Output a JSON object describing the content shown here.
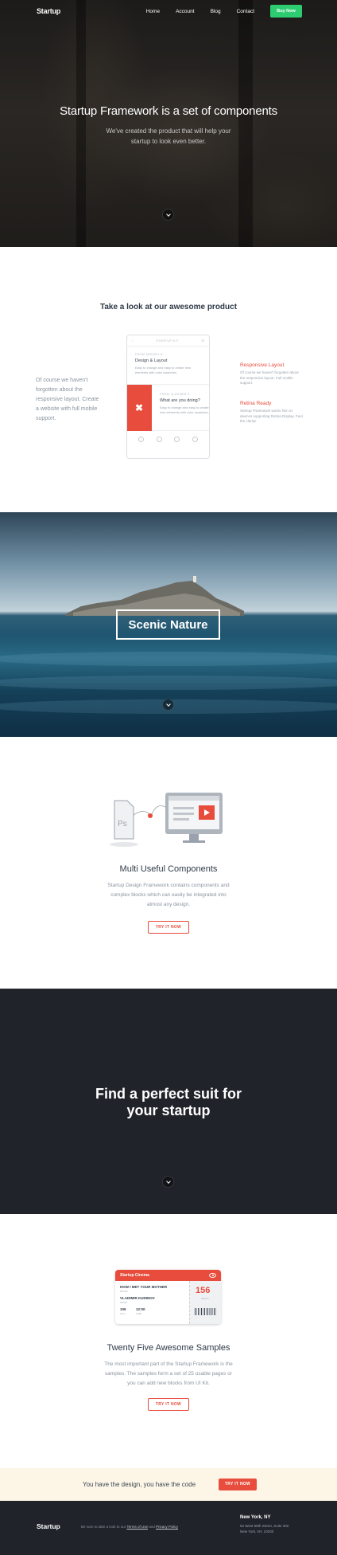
{
  "nav": {
    "brand": "Startup",
    "links": [
      "Home",
      "Account",
      "Blog",
      "Contact"
    ],
    "cta_label": "Buy Now",
    "cta_color": "#2ecc71"
  },
  "hero": {
    "title": "Startup Framework is a set of components",
    "subtitle": "We've created the product that will help your startup to look even better."
  },
  "product": {
    "title": "Take a look at our awesome product",
    "left_text": "Of course we haven't forgotten about the responsive layout. Create a website with full mobile support.",
    "phone": {
      "header": "STARTUP KIT",
      "item1_meta": "FROM SERGEY K.",
      "item1_title": "Design & Layout",
      "item1_body": "Easy to change and easy to create new elements with color swatches.",
      "item2_meta": "FROM VLADIMIR K.",
      "item2_title": "What are you doing?",
      "item2_body": "Easy to change and easy to create new elements with color swatches.",
      "item2_icon": "close-icon"
    },
    "features": [
      {
        "title": "Responsive Layout",
        "body": "Of course we haven't forgotten about the responsive layout. Full mobile support."
      },
      {
        "title": "Retina Ready",
        "body": "Startup Framework works fine on devices supporting Retina Display. Feel the clarity!"
      }
    ],
    "accent_color": "#e74c3c"
  },
  "nature": {
    "label": "Scenic Nature"
  },
  "components": {
    "title": "Multi Useful Components",
    "body": "Startup Design Framework contains components and complex blocks which can easily be integrated into almost any design.",
    "button": "TRY IT NOW"
  },
  "suit": {
    "title_line1": "Find a perfect suit for",
    "title_line2": "your startup"
  },
  "samples": {
    "ticket": {
      "header": "Startup Cinema",
      "movie": "HOW I MET YOUR MOTHER",
      "movie_label": "MOVIE",
      "name": "VLADIMIR KUDINOV",
      "name_label": "NAME",
      "hall": "106",
      "hall_label": "HALL",
      "time": "12:00",
      "time_label": "TIME",
      "seat_number": "156",
      "seat_label": "SEATS"
    },
    "title": "Twenty Five Awesome Samples",
    "body": "The most important part of the Startup Framework is the samples. The samples form a set of 25 usable pages or you can add new blocks from UI Kit.",
    "button": "TRY IT NOW"
  },
  "cta": {
    "text": "You have the design, you have the code",
    "button": "TRY IT NOW"
  },
  "footer": {
    "brand": "Startup",
    "note_prefix": "Be sure to take a look to our",
    "terms": "Terms of Use",
    "and": "and",
    "privacy": "Privacy Policy",
    "city": "New York, NY",
    "address_line1": "52 West 55th Street, Suite 302",
    "address_line2": "New York, NY, 10030"
  }
}
